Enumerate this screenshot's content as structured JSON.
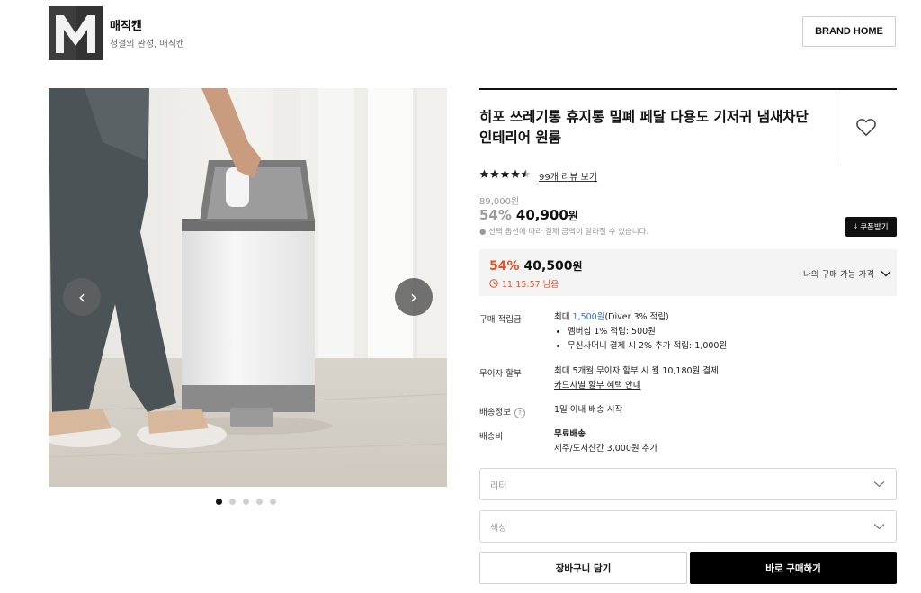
{
  "brand": {
    "name": "매직캔",
    "tagline": "청결의 완성, 매직캔",
    "home_button": "BRAND HOME"
  },
  "gallery": {
    "image_count": 5,
    "active_index": 0
  },
  "product": {
    "title": "히포 쓰레기통 휴지통 밀폐 페달 다용도 기저귀 냄새차단 인테리어 원룸",
    "rating": 4.5,
    "stars_text": "★★★★★",
    "reviews_link": "99개 리뷰 보기",
    "original_price": "89,000원",
    "discount_rate": "54%",
    "price_number": "40,900",
    "price_unit": "원",
    "price_note": "● 선택 옵션에 따라 결제 금액이 달라질 수 있습니다.",
    "coupon_button": "쿠폰받기"
  },
  "best_price": {
    "rate": "54%",
    "number": "40,500",
    "unit": "원",
    "timer": "11:15:57 남음",
    "my_price_label": "나의 구매 가능 가격"
  },
  "info": {
    "points_label": "구매 적립금",
    "points_prefix": "최대 ",
    "points_amount": "1,500원",
    "points_suffix": "(Diver 3% 적립)",
    "points_bullets": [
      "멤버십 1% 적립: 500원",
      "무신사머니 결제 시 2% 추가 적립: 1,000원"
    ],
    "installment_label": "무이자 할부",
    "installment_text": "최대 5개월 무이자 할부 시 월 10,180원 결제",
    "installment_link": "카드사별 할부 혜택 안내",
    "shipping_label": "배송정보",
    "shipping_help": "?",
    "shipping_text": "1일 이내 배송 시작",
    "fee_label": "배송비",
    "fee_text": "무료배송",
    "fee_extra": "제주/도서산간 3,000원 추가"
  },
  "options": {
    "liter_placeholder": "리터",
    "color_placeholder": "색상"
  },
  "actions": {
    "cart": "장바구니 담기",
    "buy": "바로 구매하기"
  },
  "colors": {
    "accent": "#f04e23",
    "link_blue": "#2f6fe4",
    "primary_button": "#000000"
  }
}
